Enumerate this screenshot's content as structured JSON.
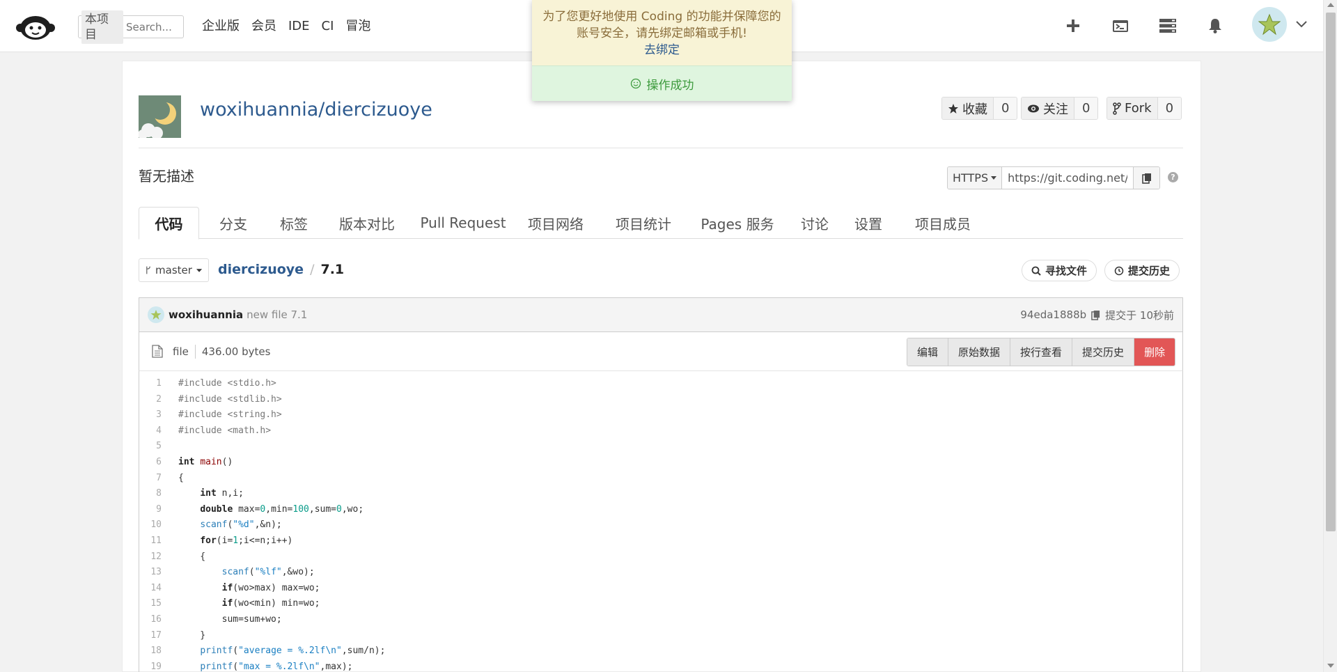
{
  "nav": {
    "scope": "本项目",
    "search_placeholder": "Search...",
    "links": [
      "企业版",
      "会员",
      "IDE",
      "CI",
      "冒泡"
    ]
  },
  "repo": {
    "title": "woxihuannia/diercizuoye",
    "description": "暂无描述",
    "stats": [
      {
        "label": "收藏",
        "count": "0",
        "icon": "star-icon"
      },
      {
        "label": "关注",
        "count": "0",
        "icon": "eye-icon"
      },
      {
        "label": "Fork",
        "count": "0",
        "icon": "fork-icon"
      }
    ],
    "clone": {
      "protocol": "HTTPS",
      "url": "https://git.coding.net/woxihuannia/diercizuoye.git"
    }
  },
  "tabs": [
    "代码",
    "分支",
    "标签",
    "版本对比",
    "Pull Request",
    "项目网络",
    "项目统计",
    "Pages 服务",
    "讨论",
    "设置",
    "项目成员"
  ],
  "branch": {
    "name": "master"
  },
  "breadcrumb": {
    "project": "diercizuoye",
    "separator": "/",
    "file": "7.1"
  },
  "actions": {
    "find_file": "寻找文件",
    "history": "提交历史"
  },
  "commit": {
    "user": "woxihuannia",
    "message": "new file 7.1",
    "hash": "94eda1888b",
    "time": "提交于 10秒前"
  },
  "file": {
    "type": "file",
    "size": "436.00 bytes",
    "buttons": [
      "编辑",
      "原始数据",
      "按行查看",
      "提交历史",
      "删除"
    ]
  },
  "toast": {
    "warning_line1": "为了您更好地使用 Coding 的功能并保障您的",
    "warning_line2": "账号安全，请先绑定邮箱或手机!",
    "warning_link": "去绑定",
    "success": "操作成功"
  },
  "code_lines": [
    {
      "n": "1",
      "t": "#include <stdio.h>"
    },
    {
      "n": "2",
      "t": "#include <stdlib.h>"
    },
    {
      "n": "3",
      "t": "#include <string.h>"
    },
    {
      "n": "4",
      "t": "#include <math.h>"
    },
    {
      "n": "5",
      "t": ""
    },
    {
      "n": "6",
      "t": "int main()"
    },
    {
      "n": "7",
      "t": "{"
    },
    {
      "n": "8",
      "t": "    int n,i;"
    },
    {
      "n": "9",
      "t": "    double max=0,min=100,sum=0,wo;"
    },
    {
      "n": "10",
      "t": "    scanf(\"%d\",&n);"
    },
    {
      "n": "11",
      "t": "    for(i=1;i<=n;i++)"
    },
    {
      "n": "12",
      "t": "    {"
    },
    {
      "n": "13",
      "t": "        scanf(\"%lf\",&wo);"
    },
    {
      "n": "14",
      "t": "        if(wo>max) max=wo;"
    },
    {
      "n": "15",
      "t": "        if(wo<min) min=wo;"
    },
    {
      "n": "16",
      "t": "        sum=sum+wo;"
    },
    {
      "n": "17",
      "t": "    }"
    },
    {
      "n": "18",
      "t": "    printf(\"average = %.2lf\\n\",sum/n);"
    },
    {
      "n": "19",
      "t": "    printf(\"max = %.2lf\\n\",max);"
    }
  ],
  "colors": {
    "link": "#2d5a8e",
    "danger": "#e25656",
    "warning_bg": "#f8f3d6",
    "success_bg": "#dff5df"
  }
}
